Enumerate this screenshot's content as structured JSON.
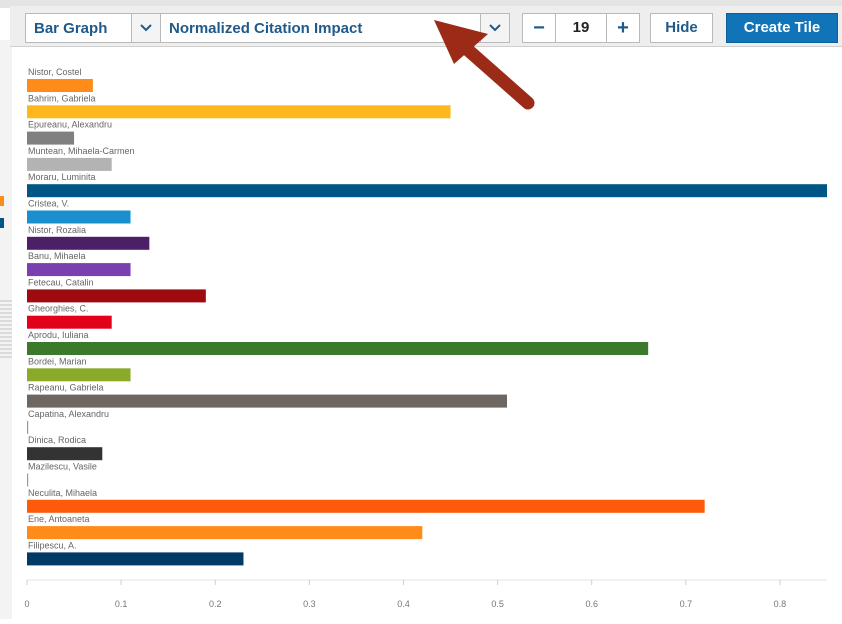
{
  "toolbar": {
    "chart_type": "Bar Graph",
    "metric": "Normalized Citation Impact",
    "count": "19",
    "minus_label": "−",
    "plus_label": "+",
    "hide_label": "Hide",
    "create_label": "Create Tile"
  },
  "colors": {
    "accent": "#1173b8",
    "arrow": "#9b2b16"
  },
  "chart_data": {
    "type": "bar",
    "orientation": "horizontal",
    "categories": [
      "Nistor, Costel",
      "Bahrim, Gabriela",
      "Epureanu, Alexandru",
      "Muntean, Mihaela-Carmen",
      "Moraru, Luminita",
      "Cristea, V.",
      "Nistor, Rozalia",
      "Banu, Mihaela",
      "Fetecau, Catalin",
      "Gheorghies, C.",
      "Aprodu, Iuliana",
      "Bordei, Marian",
      "Rapeanu, Gabriela",
      "Capatina, Alexandru",
      "Dinica, Rodica",
      "Mazilescu, Vasile",
      "Neculita, Mihaela",
      "Ene, Antoaneta",
      "Filipescu, A."
    ],
    "values": [
      0.07,
      0.45,
      0.05,
      0.09,
      0.85,
      0.11,
      0.13,
      0.11,
      0.19,
      0.09,
      0.66,
      0.11,
      0.51,
      0.0,
      0.08,
      0.0,
      0.72,
      0.42,
      0.23
    ],
    "colors": [
      "#ff8c1a",
      "#ffb81c",
      "#808080",
      "#b3b3b3",
      "#005587",
      "#1b8fcd",
      "#4d1f66",
      "#7b3fb0",
      "#9e0b0f",
      "#e3001b",
      "#3b7a2a",
      "#8aaa2a",
      "#6e6761",
      "#9a9a9a",
      "#333333",
      "#555555",
      "#ff5a0a",
      "#ff8c1a",
      "#003a66"
    ],
    "ticks": [
      "0",
      "0.1",
      "0.2",
      "0.3",
      "0.4",
      "0.5",
      "0.6",
      "0.7",
      "0.8"
    ],
    "xlim": [
      0,
      0.85
    ],
    "title": "",
    "xlabel": "",
    "ylabel": "",
    "grid": false
  }
}
